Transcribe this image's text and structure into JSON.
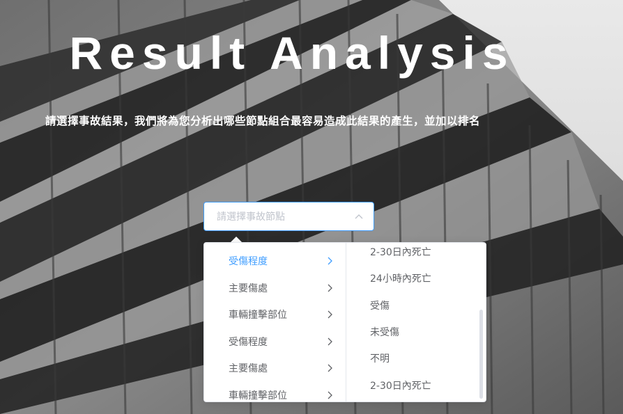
{
  "hero": {
    "title": "Result Analysis",
    "subtitle": "請選擇事故結果，我們將為您分析出哪些節點組合最容易造成此結果的產生，並加以排名"
  },
  "cascader": {
    "placeholder": "請選擇事故節點",
    "accent_color": "#409eff",
    "toggle_icon": "chevron-up-icon"
  },
  "menu_left": [
    {
      "label": "受傷程度",
      "active": true
    },
    {
      "label": "主要傷處",
      "active": false
    },
    {
      "label": "車輛撞擊部位",
      "active": false
    },
    {
      "label": "受傷程度",
      "active": false
    },
    {
      "label": "主要傷處",
      "active": false
    },
    {
      "label": "車輛撞擊部位",
      "active": false
    }
  ],
  "menu_right": [
    "2-30日內死亡",
    "24小時內死亡",
    "受傷",
    "未受傷",
    "不明",
    "2-30日內死亡"
  ]
}
